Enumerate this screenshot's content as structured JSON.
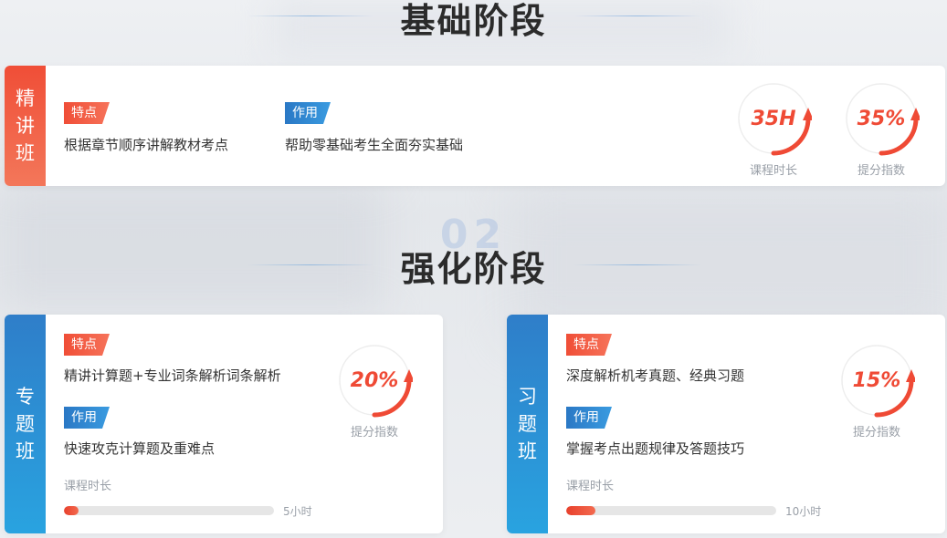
{
  "sections": {
    "basic": {
      "title": "基础阶段"
    },
    "advanced": {
      "title": "强化阶段",
      "watermark_num": "02"
    }
  },
  "cards": [
    {
      "side_chars": [
        "精",
        "讲",
        "班"
      ],
      "feature_tag": "特点",
      "feature_text": "根据章节顺序讲解教材考点",
      "effect_tag": "作用",
      "effect_text": "帮助零基础考生全面夯实基础",
      "metrics": [
        {
          "value": "35H",
          "label": "课程时长"
        },
        {
          "value": "35%",
          "label": "提分指数"
        }
      ]
    },
    {
      "side_chars": [
        "专",
        "题",
        "班"
      ],
      "feature_tag": "特点",
      "feature_text": "精讲计算题+专业词条解析词条解析",
      "effect_tag": "作用",
      "effect_text": "快速攻克计算题及重难点",
      "metric": {
        "value": "20%",
        "label": "提分指数"
      },
      "duration_label": "课程时长",
      "duration_text": "5小时",
      "duration_fraction": 0.07
    },
    {
      "side_chars": [
        "习",
        "题",
        "班"
      ],
      "feature_tag": "特点",
      "feature_text": "深度解析机考真题、经典习题",
      "effect_tag": "作用",
      "effect_text": "掌握考点出题规律及答题技巧",
      "metric": {
        "value": "15%",
        "label": "提分指数"
      },
      "duration_label": "课程时长",
      "duration_text": "10小时",
      "duration_fraction": 0.14
    }
  ],
  "colors": {
    "accent_red": "#ef4a35",
    "accent_blue": "#2f7ec9"
  },
  "icons": {
    "ring": "progress-ring-arrow-icon"
  }
}
